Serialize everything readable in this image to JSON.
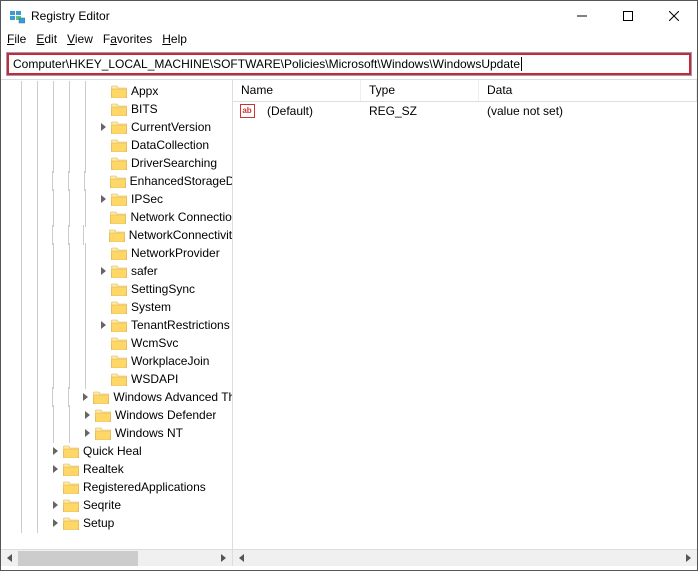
{
  "window": {
    "title": "Registry Editor"
  },
  "menu": {
    "file": "File",
    "edit": "Edit",
    "view": "View",
    "favorites": "Favorites",
    "help": "Help"
  },
  "address": {
    "path": "Computer\\HKEY_LOCAL_MACHINE\\SOFTWARE\\Policies\\Microsoft\\Windows\\WindowsUpdate"
  },
  "tree": {
    "nodes": [
      {
        "indent": 108,
        "twisty": "none",
        "label": "Appx"
      },
      {
        "indent": 108,
        "twisty": "none",
        "label": "BITS"
      },
      {
        "indent": 108,
        "twisty": "right",
        "label": "CurrentVersion"
      },
      {
        "indent": 108,
        "twisty": "none",
        "label": "DataCollection"
      },
      {
        "indent": 108,
        "twisty": "none",
        "label": "DriverSearching"
      },
      {
        "indent": 108,
        "twisty": "none",
        "label": "EnhancedStorageDevices"
      },
      {
        "indent": 108,
        "twisty": "right",
        "label": "IPSec"
      },
      {
        "indent": 108,
        "twisty": "none",
        "label": "Network Connections"
      },
      {
        "indent": 108,
        "twisty": "none",
        "label": "NetworkConnectivityStatusIndicator"
      },
      {
        "indent": 108,
        "twisty": "none",
        "label": "NetworkProvider"
      },
      {
        "indent": 108,
        "twisty": "right",
        "label": "safer"
      },
      {
        "indent": 108,
        "twisty": "none",
        "label": "SettingSync"
      },
      {
        "indent": 108,
        "twisty": "none",
        "label": "System"
      },
      {
        "indent": 108,
        "twisty": "right",
        "label": "TenantRestrictions"
      },
      {
        "indent": 108,
        "twisty": "none",
        "label": "WcmSvc"
      },
      {
        "indent": 108,
        "twisty": "none",
        "label": "WorkplaceJoin"
      },
      {
        "indent": 108,
        "twisty": "none",
        "label": "WSDAPI"
      },
      {
        "indent": 92,
        "twisty": "right",
        "label": "Windows Advanced Threat Protection"
      },
      {
        "indent": 92,
        "twisty": "right",
        "label": "Windows Defender"
      },
      {
        "indent": 92,
        "twisty": "right",
        "label": "Windows NT"
      },
      {
        "indent": 60,
        "twisty": "right",
        "label": "Quick Heal"
      },
      {
        "indent": 60,
        "twisty": "right",
        "label": "Realtek"
      },
      {
        "indent": 60,
        "twisty": "none",
        "label": "RegisteredApplications"
      },
      {
        "indent": 60,
        "twisty": "right",
        "label": "Seqrite"
      },
      {
        "indent": 60,
        "twisty": "right",
        "label": "Setup"
      }
    ]
  },
  "list": {
    "headers": {
      "name": "Name",
      "type": "Type",
      "data": "Data"
    },
    "rows": [
      {
        "name": "(Default)",
        "type": "REG_SZ",
        "data": "(value not set)",
        "icon": "ab"
      }
    ]
  }
}
